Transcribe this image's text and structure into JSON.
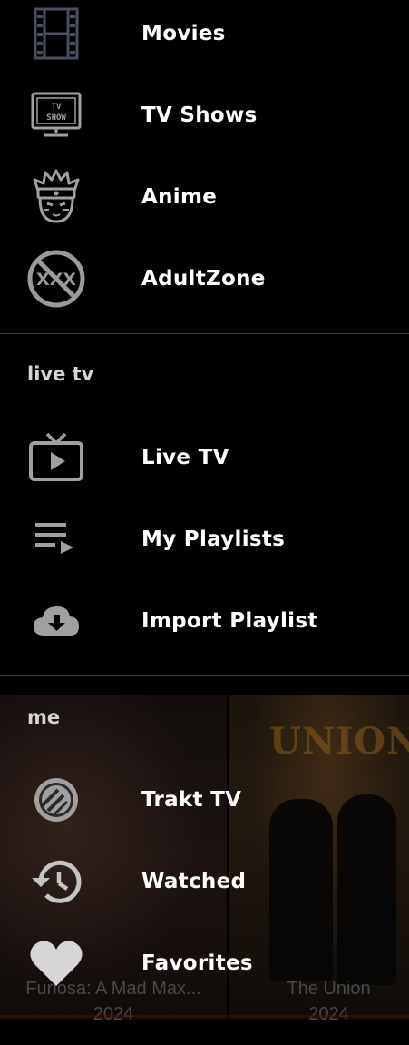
{
  "menu": {
    "items_top": [
      {
        "label": "Movies",
        "icon": "film-strip-icon"
      },
      {
        "label": "TV Shows",
        "icon": "tv-show-icon"
      },
      {
        "label": "Anime",
        "icon": "anime-ninja-icon"
      },
      {
        "label": "AdultZone",
        "icon": "xxx-prohibited-icon"
      }
    ],
    "section_live": {
      "header": "live tv",
      "items": [
        {
          "label": "Live TV",
          "icon": "tv-play-icon"
        },
        {
          "label": "My Playlists",
          "icon": "playlist-icon"
        },
        {
          "label": "Import Playlist",
          "icon": "cloud-download-icon"
        }
      ]
    },
    "section_me": {
      "header": "me",
      "items": [
        {
          "label": "Trakt TV",
          "icon": "trakt-logo-icon"
        },
        {
          "label": "Watched",
          "icon": "history-icon"
        },
        {
          "label": "Favorites",
          "icon": "heart-icon"
        }
      ]
    }
  },
  "background": {
    "posters": [
      {
        "title": "Furiosa: A Mad Max...",
        "year": "2024"
      },
      {
        "title": "The Union",
        "year": "2024"
      }
    ]
  },
  "colors": {
    "background": "#000000",
    "text": "#ffffff",
    "section_header": "#d6d6d6",
    "icon": "#9a9a9a",
    "divider": "#3a3a3a"
  }
}
